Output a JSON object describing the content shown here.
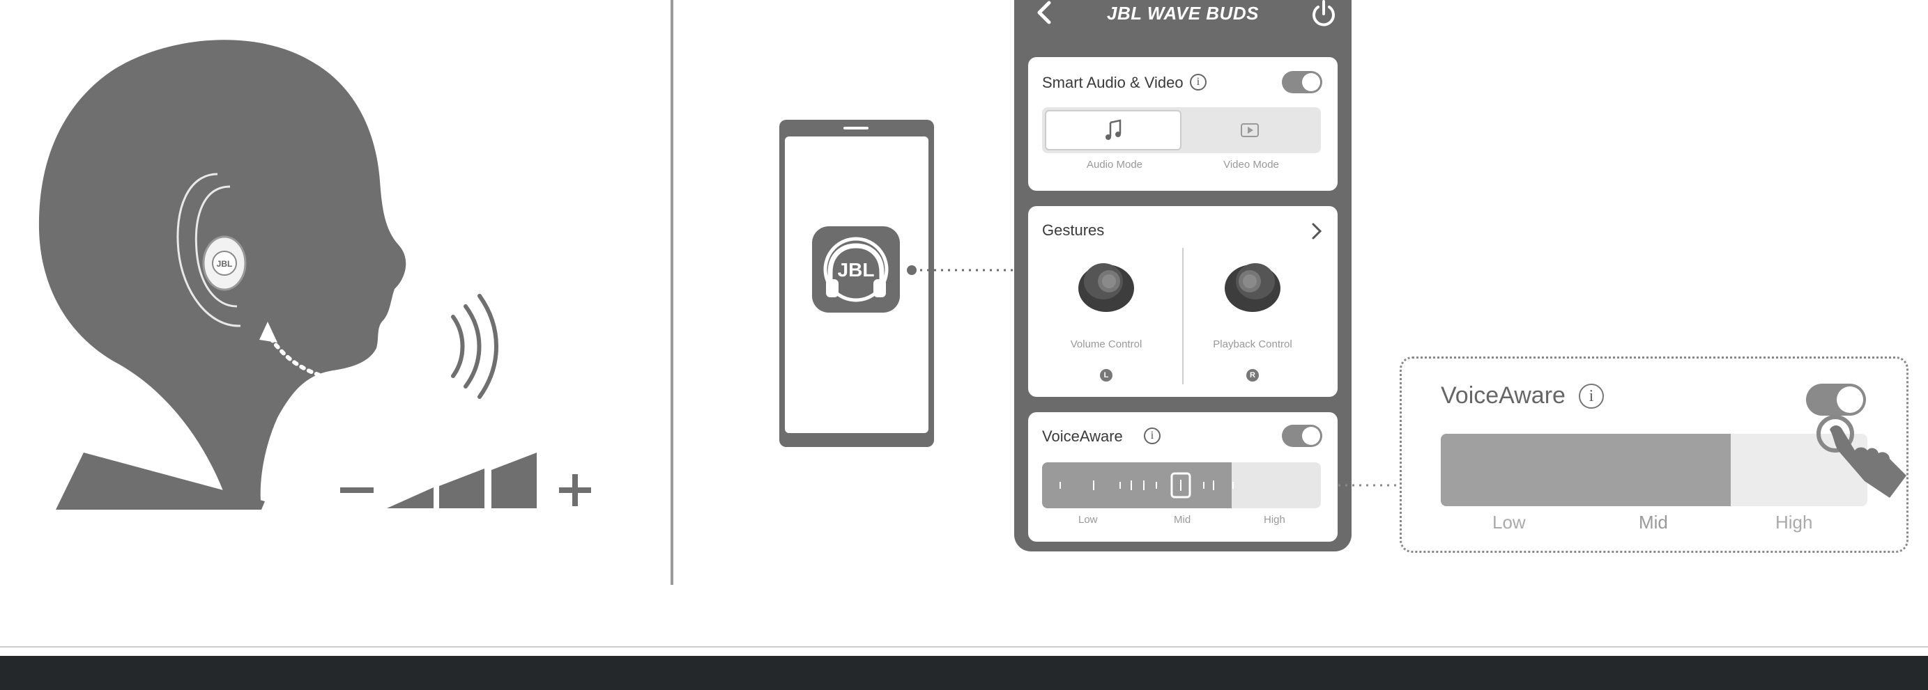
{
  "app": {
    "title": "JBL WAVE BUDS",
    "icon_logo": "JBL"
  },
  "smart_audio": {
    "title": "Smart Audio & Video",
    "info": "i",
    "toggle_on": true,
    "modes": [
      {
        "label": "Audio Mode",
        "icon": "music-note-icon",
        "selected": true
      },
      {
        "label": "Video Mode",
        "icon": "video-play-icon",
        "selected": false
      }
    ]
  },
  "gestures": {
    "title": "Gestures",
    "items": [
      {
        "label": "Volume Control",
        "side": "L"
      },
      {
        "label": "Playback Control",
        "side": "R"
      }
    ]
  },
  "voiceaware": {
    "title": "VoiceAware",
    "info": "i",
    "toggle_on": true,
    "level": 0.68,
    "levels": [
      "Low",
      "Mid",
      "High"
    ]
  },
  "zoom": {
    "title": "VoiceAware",
    "info": "i",
    "toggle_on": true,
    "level": 0.68,
    "levels": [
      "Low",
      "Mid",
      "High"
    ]
  },
  "volume_scale": {
    "minus": "−",
    "plus": "+"
  },
  "colors": {
    "primary_gray": "#6d6d6d",
    "footer_dark": "#25282b"
  }
}
